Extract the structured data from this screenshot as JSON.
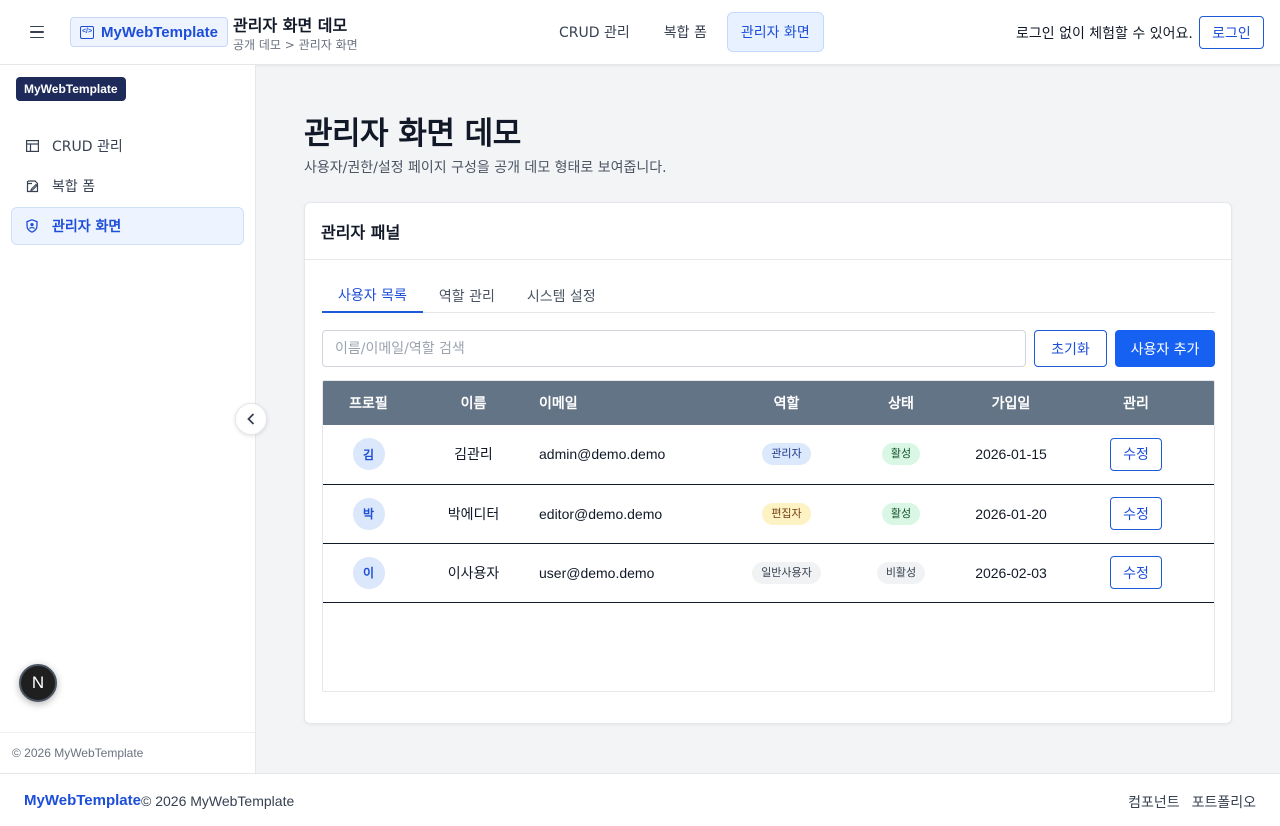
{
  "header": {
    "brand": "MyWebTemplate",
    "title": "관리자 화면 데모",
    "breadcrumb": "공개 데모 > 관리자 화면",
    "nav": [
      {
        "label": "CRUD 관리",
        "active": false
      },
      {
        "label": "복합 폼",
        "active": false
      },
      {
        "label": "관리자 화면",
        "active": true
      }
    ],
    "login_note": "로그인 없이 체험할 수 있어요.",
    "login_label": "로그인"
  },
  "sidebar": {
    "badge": "MyWebTemplate",
    "items": [
      {
        "label": "CRUD 관리",
        "icon": "table-icon",
        "active": false
      },
      {
        "label": "복합 폼",
        "icon": "edit-form-icon",
        "active": false
      },
      {
        "label": "관리자 화면",
        "icon": "shield-user-icon",
        "active": true
      }
    ],
    "footer": "© 2026 MyWebTemplate",
    "fab_label": "N"
  },
  "main": {
    "title": "관리자 화면 데모",
    "description": "사용자/권한/설정 페이지 구성을 공개 데모 형태로 보여줍니다.",
    "panel": {
      "title": "관리자 패널",
      "tabs": [
        {
          "label": "사용자 목록",
          "active": true
        },
        {
          "label": "역할 관리",
          "active": false
        },
        {
          "label": "시스템 설정",
          "active": false
        }
      ],
      "search": {
        "placeholder": "이름/이메일/역할 검색",
        "value": ""
      },
      "reset_label": "초기화",
      "add_label": "사용자 추가",
      "table": {
        "columns": [
          "프로필",
          "이름",
          "이메일",
          "역할",
          "상태",
          "가입일",
          "관리"
        ],
        "rows": [
          {
            "avatar": "김",
            "name": "김관리",
            "email": "admin@demo.demo",
            "role": "관리자",
            "status": "활성",
            "joined": "2026-01-15",
            "action": "수정"
          },
          {
            "avatar": "박",
            "name": "박에디터",
            "email": "editor@demo.demo",
            "role": "편집자",
            "status": "활성",
            "joined": "2026-01-20",
            "action": "수정"
          },
          {
            "avatar": "이",
            "name": "이사용자",
            "email": "user@demo.demo",
            "role": "일반사용자",
            "status": "비활성",
            "joined": "2026-02-03",
            "action": "수정"
          }
        ]
      }
    }
  },
  "footer": {
    "brand": "MyWebTemplate",
    "copyright": "© 2026 MyWebTemplate",
    "links": [
      "컴포넌트",
      "포트폴리오"
    ]
  },
  "colors": {
    "accent": "#1660f2",
    "table_header": "#647487",
    "role_admin": "#dce8fb",
    "role_editor": "#fdf2c3",
    "role_user": "#f1f2f4",
    "status_active": "#d9f7e4",
    "status_inactive": "#f1f2f4"
  }
}
